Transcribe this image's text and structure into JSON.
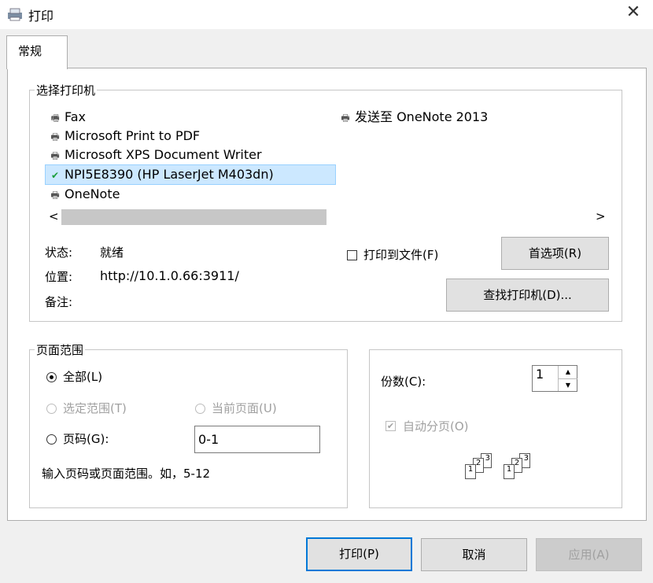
{
  "window": {
    "title": "打印",
    "close": "✕"
  },
  "tabs": [
    {
      "label": "常规"
    }
  ],
  "printer_group": {
    "title": "选择打印机",
    "printers_left": [
      {
        "name": "Fax",
        "icon": "fax-printer-icon"
      },
      {
        "name": "Microsoft Print to PDF",
        "icon": "printer-icon"
      },
      {
        "name": "Microsoft XPS Document Writer",
        "icon": "printer-icon"
      },
      {
        "name": "NPI5E8390 (HP LaserJet M403dn)",
        "icon": "default-printer-icon",
        "selected": true
      },
      {
        "name": "OneNote",
        "icon": "printer-icon"
      }
    ],
    "printers_right": [
      {
        "name": "发送至 OneNote 2013",
        "icon": "printer-icon"
      }
    ],
    "scroll_left": "<",
    "scroll_right": ">",
    "status_label": "状态:",
    "status_value": "就绪",
    "location_label": "位置:",
    "location_value": "http://10.1.0.66:3911/",
    "comment_label": "备注:",
    "comment_value": "",
    "print_to_file": "打印到文件(F)",
    "preferences_button": "首选项(R)",
    "find_printer_button": "查找打印机(D)..."
  },
  "page_range": {
    "title": "页面范围",
    "all": "全部(L)",
    "selection": "选定范围(T)",
    "current_page": "当前页面(U)",
    "pages": "页码(G):",
    "pages_value": "0-1",
    "hint": "输入页码或页面范围。如，5-12"
  },
  "copies": {
    "label": "份数(C):",
    "value": "1",
    "collate": "自动分页(O)",
    "collate_checked": true,
    "spin_up": "▲",
    "spin_down": "▼",
    "collate_pages": [
      "1",
      "2",
      "3"
    ]
  },
  "footer": {
    "print": "打印(P)",
    "cancel": "取消",
    "apply": "应用(A)"
  },
  "colors": {
    "accent": "#0078d7",
    "selection": "#cce8ff",
    "disabled": "#a0a0a0"
  }
}
